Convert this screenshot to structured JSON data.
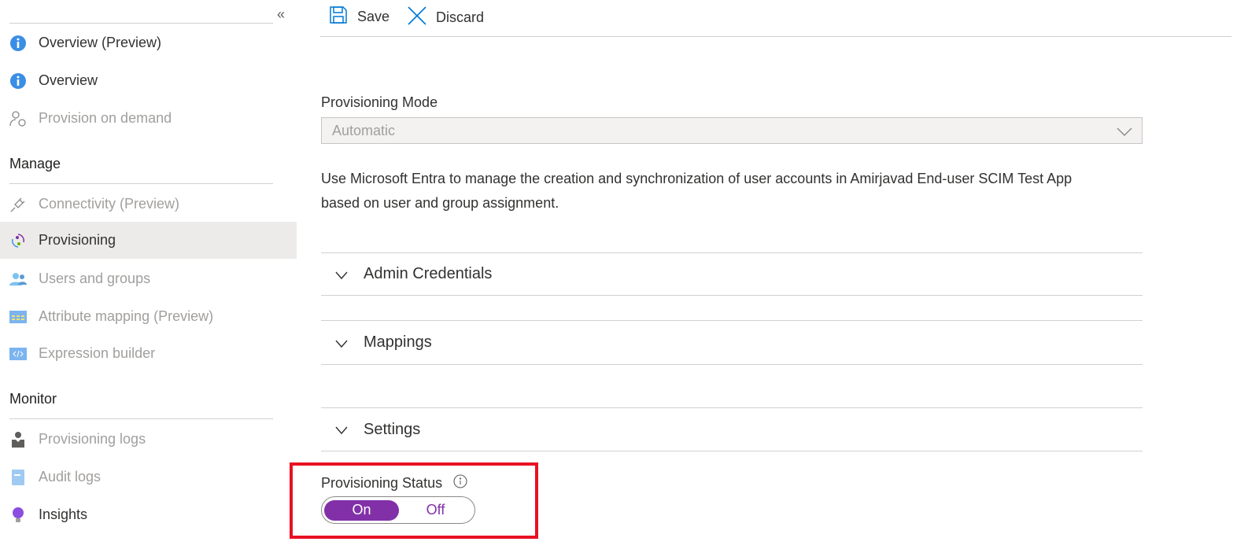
{
  "sidebar": {
    "collapse_label": "«",
    "items_top": [
      {
        "label": "Overview (Preview)",
        "icon": "info-icon"
      },
      {
        "label": "Overview",
        "icon": "info-icon"
      },
      {
        "label": "Provision on demand",
        "icon": "user-sync-icon"
      }
    ],
    "manage_header": "Manage",
    "manage_items": [
      {
        "label": "Connectivity (Preview)",
        "icon": "plug-icon"
      },
      {
        "label": "Provisioning",
        "icon": "provisioning-icon"
      },
      {
        "label": "Users and groups",
        "icon": "users-icon"
      },
      {
        "label": "Attribute mapping (Preview)",
        "icon": "table-icon"
      },
      {
        "label": "Expression builder",
        "icon": "code-icon"
      }
    ],
    "monitor_header": "Monitor",
    "monitor_items": [
      {
        "label": "Provisioning logs",
        "icon": "log-user-icon"
      },
      {
        "label": "Audit logs",
        "icon": "book-icon"
      },
      {
        "label": "Insights",
        "icon": "lightbulb-icon"
      }
    ]
  },
  "toolbar": {
    "save_label": "Save",
    "discard_label": "Discard"
  },
  "main": {
    "mode_label": "Provisioning Mode",
    "mode_value": "Automatic",
    "description_line1": "Use Microsoft Entra to manage the creation and synchronization of user accounts in Amirjavad End-user SCIM Test App",
    "description_line2": "based on user and group assignment.",
    "sections": [
      "Admin Credentials",
      "Mappings",
      "Settings"
    ],
    "status_label": "Provisioning Status",
    "toggle": {
      "on": "On",
      "off": "Off",
      "selected": "On"
    }
  },
  "colors": {
    "accent": "#8130a8",
    "highlight": "#e81123",
    "link": "#0078d4"
  }
}
